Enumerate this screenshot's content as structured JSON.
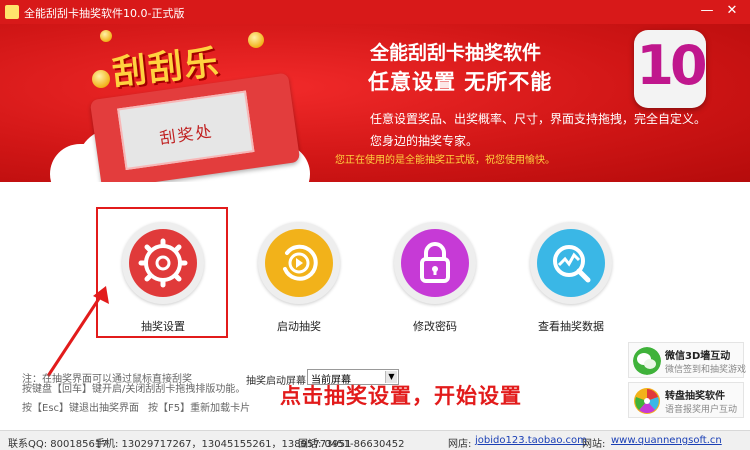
{
  "window": {
    "title": "全能刮刮卡抽奖软件10.0-正式版",
    "minimize": "—",
    "close": "✕"
  },
  "banner": {
    "logo": "刮刮乐",
    "ticket_text": "刮奖处",
    "app_name": "全能刮刮卡抽奖软件",
    "slogan": "任意设置  无所不能",
    "description": "任意设置奖品、出奖概率、尺寸，界面支持拖拽，完全自定义。",
    "tagline": "您身边的抽奖专家。",
    "notice": "您正在使用的是全能抽奖正式版，祝您使用愉快。",
    "version_badge": "10"
  },
  "features": [
    {
      "label": "抽奖设置",
      "icon": "gear-icon",
      "color": "#e03a3a"
    },
    {
      "label": "启动抽奖",
      "icon": "play-icon",
      "color": "#f2b21a"
    },
    {
      "label": "修改密码",
      "icon": "lock-icon",
      "color": "#c63ad6"
    },
    {
      "label": "查看抽奖数据",
      "icon": "chart-search-icon",
      "color": "#3ab7e6"
    }
  ],
  "notes": {
    "line1": "注：在抽奖界面可以通过鼠标直接刮奖",
    "line2": "按键盘【回车】键开启/关闭刮刮卡拖拽排版功能。",
    "hotkey_esc": "按【Esc】键退出抽奖界面",
    "hotkey_f5": "按【F5】重新加载卡片"
  },
  "screen": {
    "label": "抽奖启动屏幕",
    "value": "当前屏幕"
  },
  "hint": "点击抽奖设置，开始设置",
  "side_cards": [
    {
      "title": "微信3D墙互动",
      "subtitle": "微信签到和抽奖游戏",
      "icon": "wechat-icon"
    },
    {
      "title": "转盘抽奖软件",
      "subtitle": "语音报奖用户互动",
      "icon": "wheel-icon"
    }
  ],
  "status": {
    "qq": "联系QQ: 800185617",
    "phone": "手机: 13029717267，13045155261，13895773951",
    "tel": "固话: 0451-86630452",
    "web1_label": "网店:",
    "web1": "jobido123.taobao.com",
    "web2_label": "网站:",
    "web2": "www.quannengsoft.cn"
  },
  "colors": {
    "accent": "#d81919",
    "highlight": "#e21b1b",
    "gold": "#ffd23f"
  }
}
